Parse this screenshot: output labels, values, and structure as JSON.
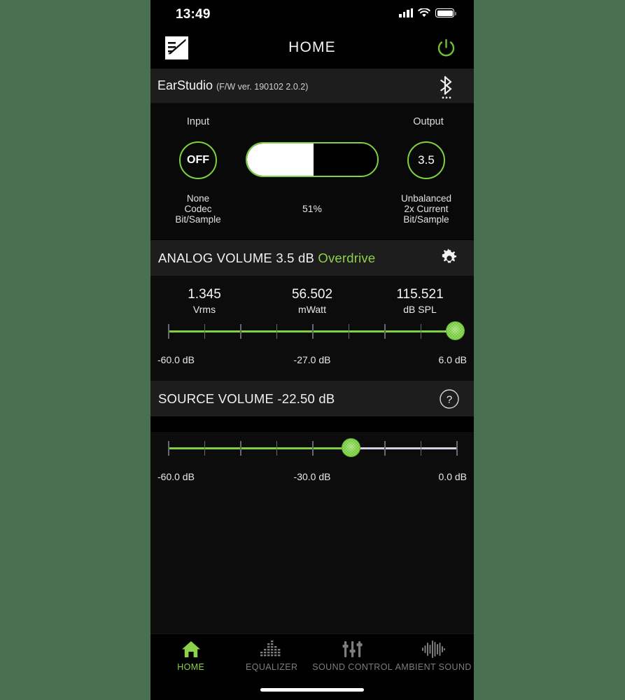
{
  "theme": {
    "accent_green": "#7ed13f",
    "label_green": "#8cd14a",
    "panel_bg": "#0c0c0c",
    "header_bg": "#1d1d1d",
    "outer_bg": "#4a7052",
    "track_inactive": "#cfd2e0"
  },
  "status_bar": {
    "time": "13:49",
    "signal_icon": "cellular-signal-icon",
    "wifi_icon": "wifi-icon",
    "battery_icon": "battery-full-icon"
  },
  "nav_bar": {
    "menu_icon": "earstudio-logo-menu-icon",
    "title": "HOME",
    "power_icon": "power-icon"
  },
  "device": {
    "name": "EarStudio",
    "firmware": "(F/W ver. 190102 2.0.2)",
    "bluetooth_icon": "bluetooth-icon"
  },
  "io_panel": {
    "input": {
      "label": "Input",
      "value": "OFF",
      "sub_lines": [
        "None",
        "Codec",
        "Bit/Sample"
      ]
    },
    "output": {
      "label": "Output",
      "value": "3.5",
      "sub_lines": [
        "Unbalanced",
        "2x Current",
        "Bit/Sample"
      ]
    },
    "volume": {
      "percent_label": "51%",
      "percent_value": 51
    }
  },
  "analog_volume": {
    "header_title": "ANALOG VOLUME 3.5 dB",
    "header_accent": "Overdrive",
    "settings_icon": "gear-icon",
    "readouts": [
      {
        "value": "1.345",
        "unit": "Vrms"
      },
      {
        "value": "56.502",
        "unit": "mWatt"
      },
      {
        "value": "115.521",
        "unit": "dB SPL"
      }
    ],
    "slider": {
      "min_label": "-60.0 dB",
      "mid_label": "-27.0 dB",
      "max_label": "6.0 dB",
      "min": -60.0,
      "max": 6.0,
      "value": 3.5,
      "tick_count": 8
    }
  },
  "source_volume": {
    "header_title": "SOURCE VOLUME -22.50 dB",
    "help_icon": "question-mark-icon",
    "slider": {
      "min_label": "-60.0 dB",
      "mid_label": "-30.0 dB",
      "max_label": "0.0 dB",
      "min": -60.0,
      "max": 0.0,
      "value": -22.5,
      "tick_count": 8
    }
  },
  "tab_bar": {
    "tabs": [
      {
        "label": "HOME",
        "icon": "home-icon",
        "active": true
      },
      {
        "label": "EQUALIZER",
        "icon": "equalizer-bars-icon",
        "active": false
      },
      {
        "label": "SOUND CONTROL",
        "icon": "sliders-icon",
        "active": false
      },
      {
        "label": "AMBIENT SOUND",
        "icon": "waveform-icon",
        "active": false
      }
    ],
    "home_indicator": "home-indicator-bar"
  }
}
